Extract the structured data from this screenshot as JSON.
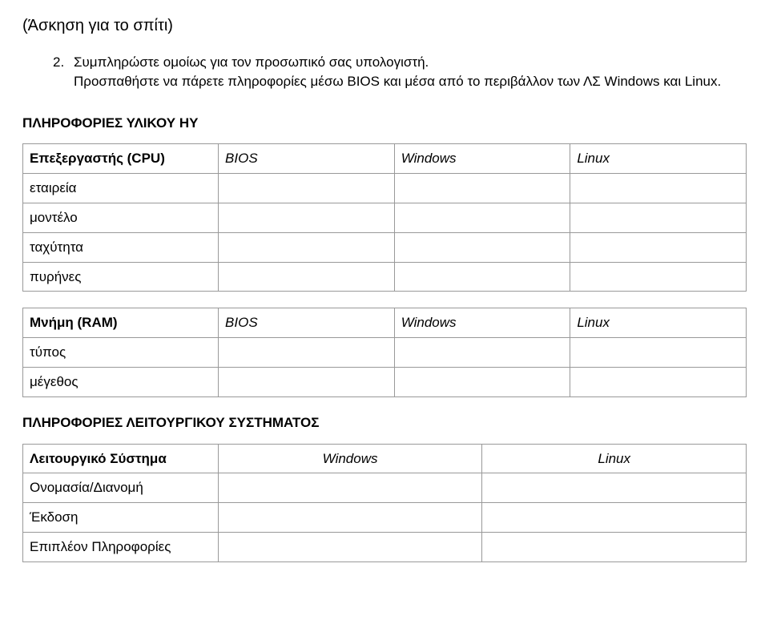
{
  "title": "(Άσκηση για το σπίτι)",
  "instruction": {
    "number": "2.",
    "line1": "Συμπληρώστε ομοίως για τον προσωπικό σας υπολογιστή.",
    "line2": "Προσπαθήστε να πάρετε πληροφορίες μέσω BIOS και μέσα από το περιβάλλον των ΛΣ Windows και Linux."
  },
  "hw_heading": "ΠΛΗΡΟΦΟΡΙΕΣ ΥΛΙΚΟΥ ΗΥ",
  "cpu_table": {
    "header": {
      "label": "Επεξεργαστής (CPU)",
      "bios": "BIOS",
      "windows": "Windows",
      "linux": "Linux"
    },
    "rows": [
      {
        "label": "εταιρεία"
      },
      {
        "label": "μοντέλο"
      },
      {
        "label": "ταχύτητα"
      },
      {
        "label": "πυρήνες"
      }
    ]
  },
  "ram_table": {
    "header": {
      "label": "Μνήμη (RAM)",
      "bios": "BIOS",
      "windows": "Windows",
      "linux": "Linux"
    },
    "rows": [
      {
        "label": "τύπος"
      },
      {
        "label": "μέγεθος"
      }
    ]
  },
  "os_heading": "ΠΛΗΡΟΦΟΡΙΕΣ ΛΕΙΤΟΥΡΓΙΚΟΥ ΣΥΣΤΗΜΑΤΟΣ",
  "os_table": {
    "header": {
      "label": "Λειτουργικό Σύστημα",
      "windows": "Windows",
      "linux": "Linux"
    },
    "rows": [
      {
        "label": "Ονομασία/Διανομή"
      },
      {
        "label": "Έκδοση"
      },
      {
        "label": "Επιπλέον Πληροφορίες"
      }
    ]
  }
}
